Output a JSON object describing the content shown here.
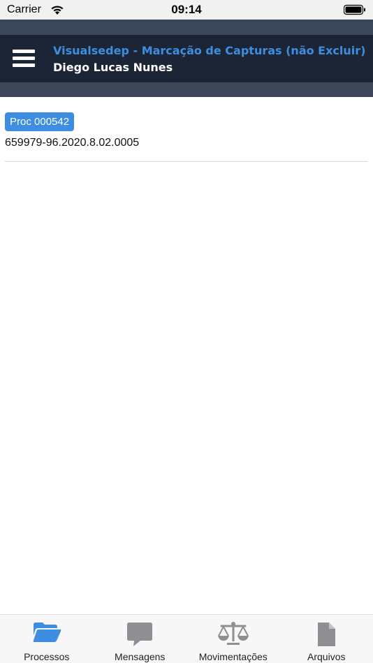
{
  "status_bar": {
    "carrier": "Carrier",
    "time": "09:14"
  },
  "header": {
    "title": "Visualsedep - Marcação de Capturas (não Excluir)",
    "user": "Diego Lucas Nunes"
  },
  "processes": [
    {
      "badge": "Proc 000542",
      "number": "659979-96.2020.8.02.0005"
    }
  ],
  "tabs": [
    {
      "label": "Processos",
      "icon": "folder-open-icon",
      "active": true
    },
    {
      "label": "Mensagens",
      "icon": "chat-bubble-icon",
      "active": false
    },
    {
      "label": "Movimentações",
      "icon": "balance-scale-icon",
      "active": false
    },
    {
      "label": "Arquivos",
      "icon": "file-icon",
      "active": false
    }
  ],
  "colors": {
    "accent": "#3d8ee0",
    "header_bg": "#1c2535",
    "band_bg": "#3b4658",
    "inactive_icon": "#8e8e93"
  }
}
